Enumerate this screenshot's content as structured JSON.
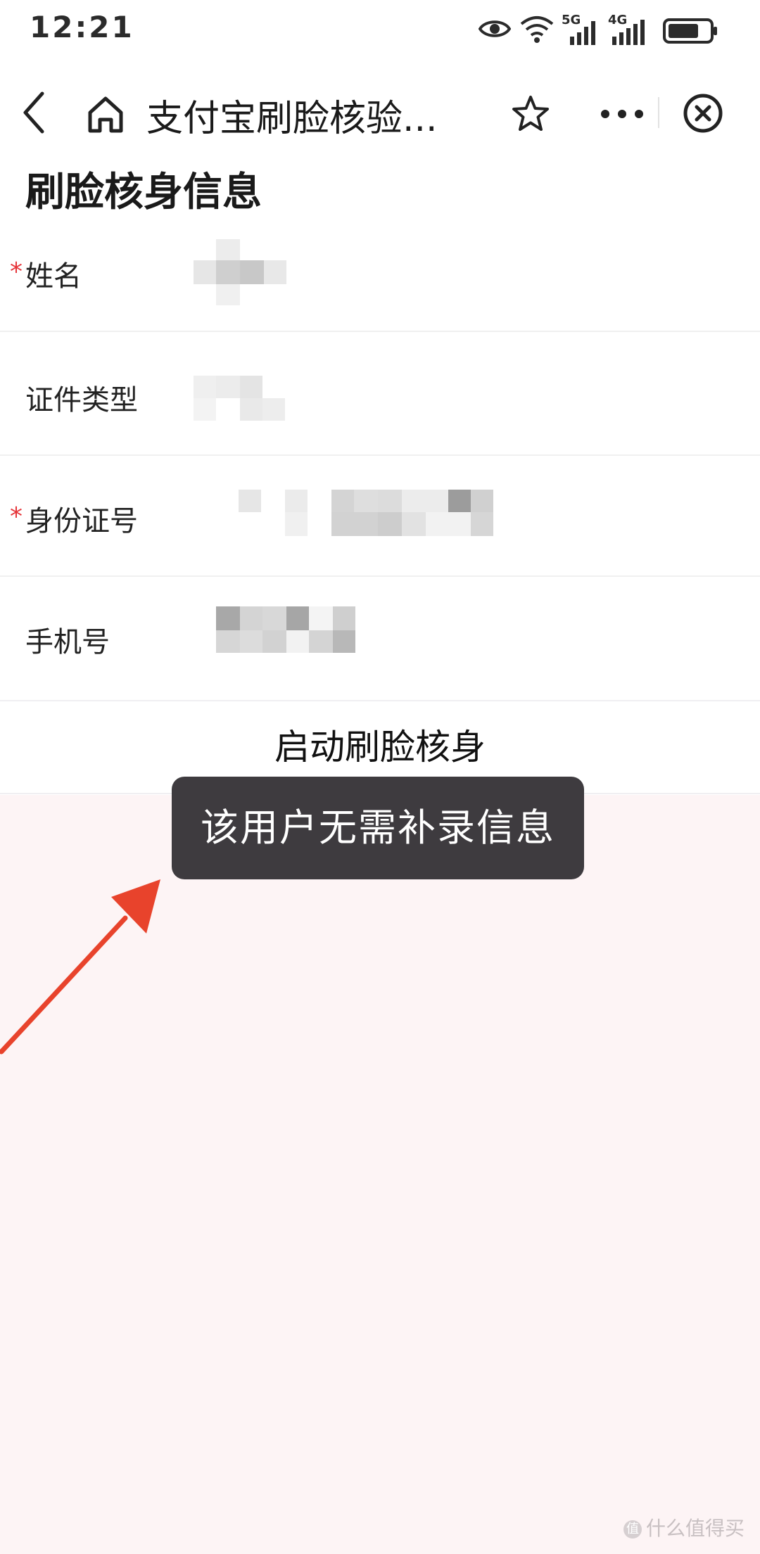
{
  "status_bar": {
    "time": "12:21",
    "network_5g": "5G",
    "network_4g": "4G"
  },
  "nav": {
    "title": "支付宝刷脸核验...",
    "icons": [
      "back-icon",
      "home-icon",
      "star-icon",
      "more-icon",
      "close-circle-icon"
    ]
  },
  "page": {
    "title": "刷脸核身信息"
  },
  "form": {
    "fields": [
      {
        "label": "姓名",
        "required": true,
        "value_redacted": true
      },
      {
        "label": "证件类型",
        "required": false,
        "value_redacted": true
      },
      {
        "label": "身份证号",
        "required": true,
        "value_redacted": true
      },
      {
        "label": "手机号",
        "required": false,
        "value_redacted": true
      }
    ],
    "required_mark": "*"
  },
  "actions": {
    "start_label": "启动刷脸核身"
  },
  "toast": {
    "message": "该用户无需补录信息"
  },
  "watermark": {
    "badge": "值",
    "text": "什么值得买"
  },
  "colors": {
    "required": "#e6353a",
    "toast_bg": "#3e3b3f",
    "lower_bg": "#fdf4f5",
    "arrow": "#e8432c"
  }
}
